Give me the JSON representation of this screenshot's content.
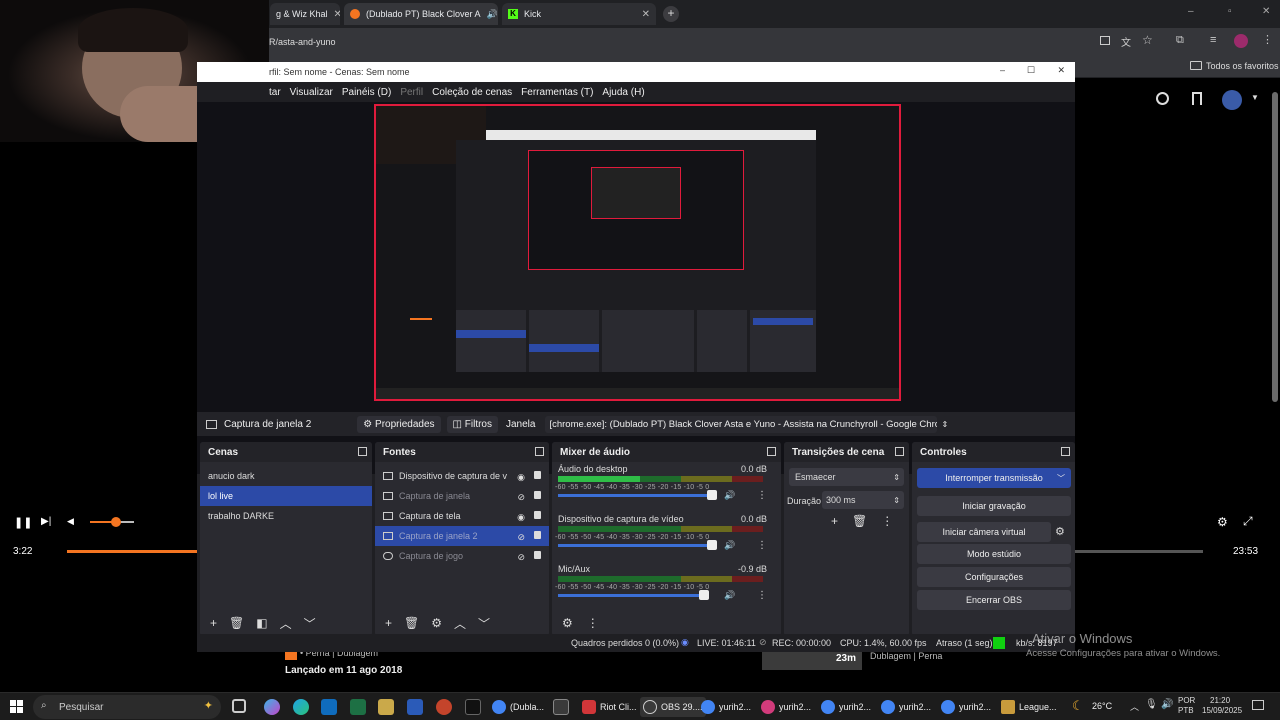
{
  "chrome": {
    "tabs": [
      {
        "label": "g & Wiz Khal"
      },
      {
        "label": "(Dublado PT) Black Clover A"
      },
      {
        "label": "Kick"
      }
    ],
    "url_fragment": "R/asta-and-yuno",
    "bookmarks_label": "Todos os favoritos"
  },
  "video": {
    "current_time": "3:22",
    "total_time": "23:53",
    "progress_fraction": 0.14,
    "volume_fraction": 0.6
  },
  "page_below": {
    "badge": "• Perna | Dublagem",
    "launch": "Lançado em 11 ago 2018",
    "thumb_duration": "23m",
    "thumb_label": "Dublagem | Perna"
  },
  "obs": {
    "title": "rfil: Sem nome - Cenas: Sem nome",
    "menu": [
      "tar",
      "Visualizar",
      "Painéis (D)",
      "Perfil",
      "Coleção de cenas",
      "Ferramentas (T)",
      "Ajuda (H)"
    ],
    "source_toolbar": {
      "source_name": "Captura de janela 2",
      "properties": "Propriedades",
      "filters": "Filtros",
      "window_label": "Janela",
      "window_value": "[chrome.exe]: (Dublado PT) Black Clover Asta e Yuno - Assista na Crunchyroll - Google Chrome"
    },
    "scenes": {
      "title": "Cenas",
      "items": [
        "anucio dark",
        "lol live",
        "trabalho DARKE"
      ]
    },
    "sources": {
      "title": "Fontes",
      "items": [
        "Dispositivo de captura de v",
        "Captura de janela",
        "Captura de tela",
        "Captura de janela 2",
        "Captura de jogo"
      ]
    },
    "mixer": {
      "title": "Mixer de áudio",
      "scale": "-60 -55 -50 -45 -40 -35 -30 -25 -20 -15 -10 -5 0",
      "channels": [
        {
          "name": "Áudio do desktop",
          "db": "0.0 dB"
        },
        {
          "name": "Dispositivo de captura de vídeo",
          "db": "0.0 dB"
        },
        {
          "name": "Mic/Aux",
          "db": "-0.9 dB"
        }
      ]
    },
    "transitions": {
      "title": "Transições de cena",
      "transition": "Esmaecer",
      "duration_label": "Duração",
      "duration_value": "300 ms"
    },
    "controls": {
      "title": "Controles",
      "stop_stream": "Interromper transmissão",
      "start_recording": "Iniciar gravação",
      "virtual_cam": "Iniciar câmera virtual",
      "studio_mode": "Modo estúdio",
      "settings": "Configurações",
      "exit": "Encerrar OBS"
    },
    "status": {
      "frames": "Quadros perdidos 0 (0.0%)",
      "live": "LIVE: 01:46:11",
      "rec": "REC: 00:00:00",
      "cpu": "CPU: 1.4%, 60.00 fps",
      "delay": "Atraso (1 seg)",
      "kbps": "kb/s: 8197"
    }
  },
  "windows_watermark": {
    "title": "Ativar o Windows",
    "subtitle": "Acesse Configurações para ativar o Windows."
  },
  "taskbar": {
    "search_placeholder": "Pesquisar",
    "apps": [
      {
        "label": "(Dubla...",
        "color": "#4285f4"
      },
      {
        "label": "Riot Cli...",
        "color": "#d13639"
      },
      {
        "label": "OBS 29....",
        "color": "#3a3a3a"
      },
      {
        "label": "yurih2...",
        "color": "#4285f4"
      },
      {
        "label": "yurih2...",
        "color": "#d23b7b"
      },
      {
        "label": "yurih2...",
        "color": "#4285f4"
      },
      {
        "label": "yurih2...",
        "color": "#4285f4"
      },
      {
        "label": "yurih2...",
        "color": "#4285f4"
      },
      {
        "label": "League...",
        "color": "#c89b3c"
      }
    ],
    "weather": "26°C",
    "lang": "POR",
    "layout": "PTB",
    "time": "21:20",
    "date": "15/09/2025"
  },
  "colors": {
    "obs_accent": "#2c4aa7",
    "preview_border": "#e01b3c",
    "live_square": "#10d010"
  }
}
